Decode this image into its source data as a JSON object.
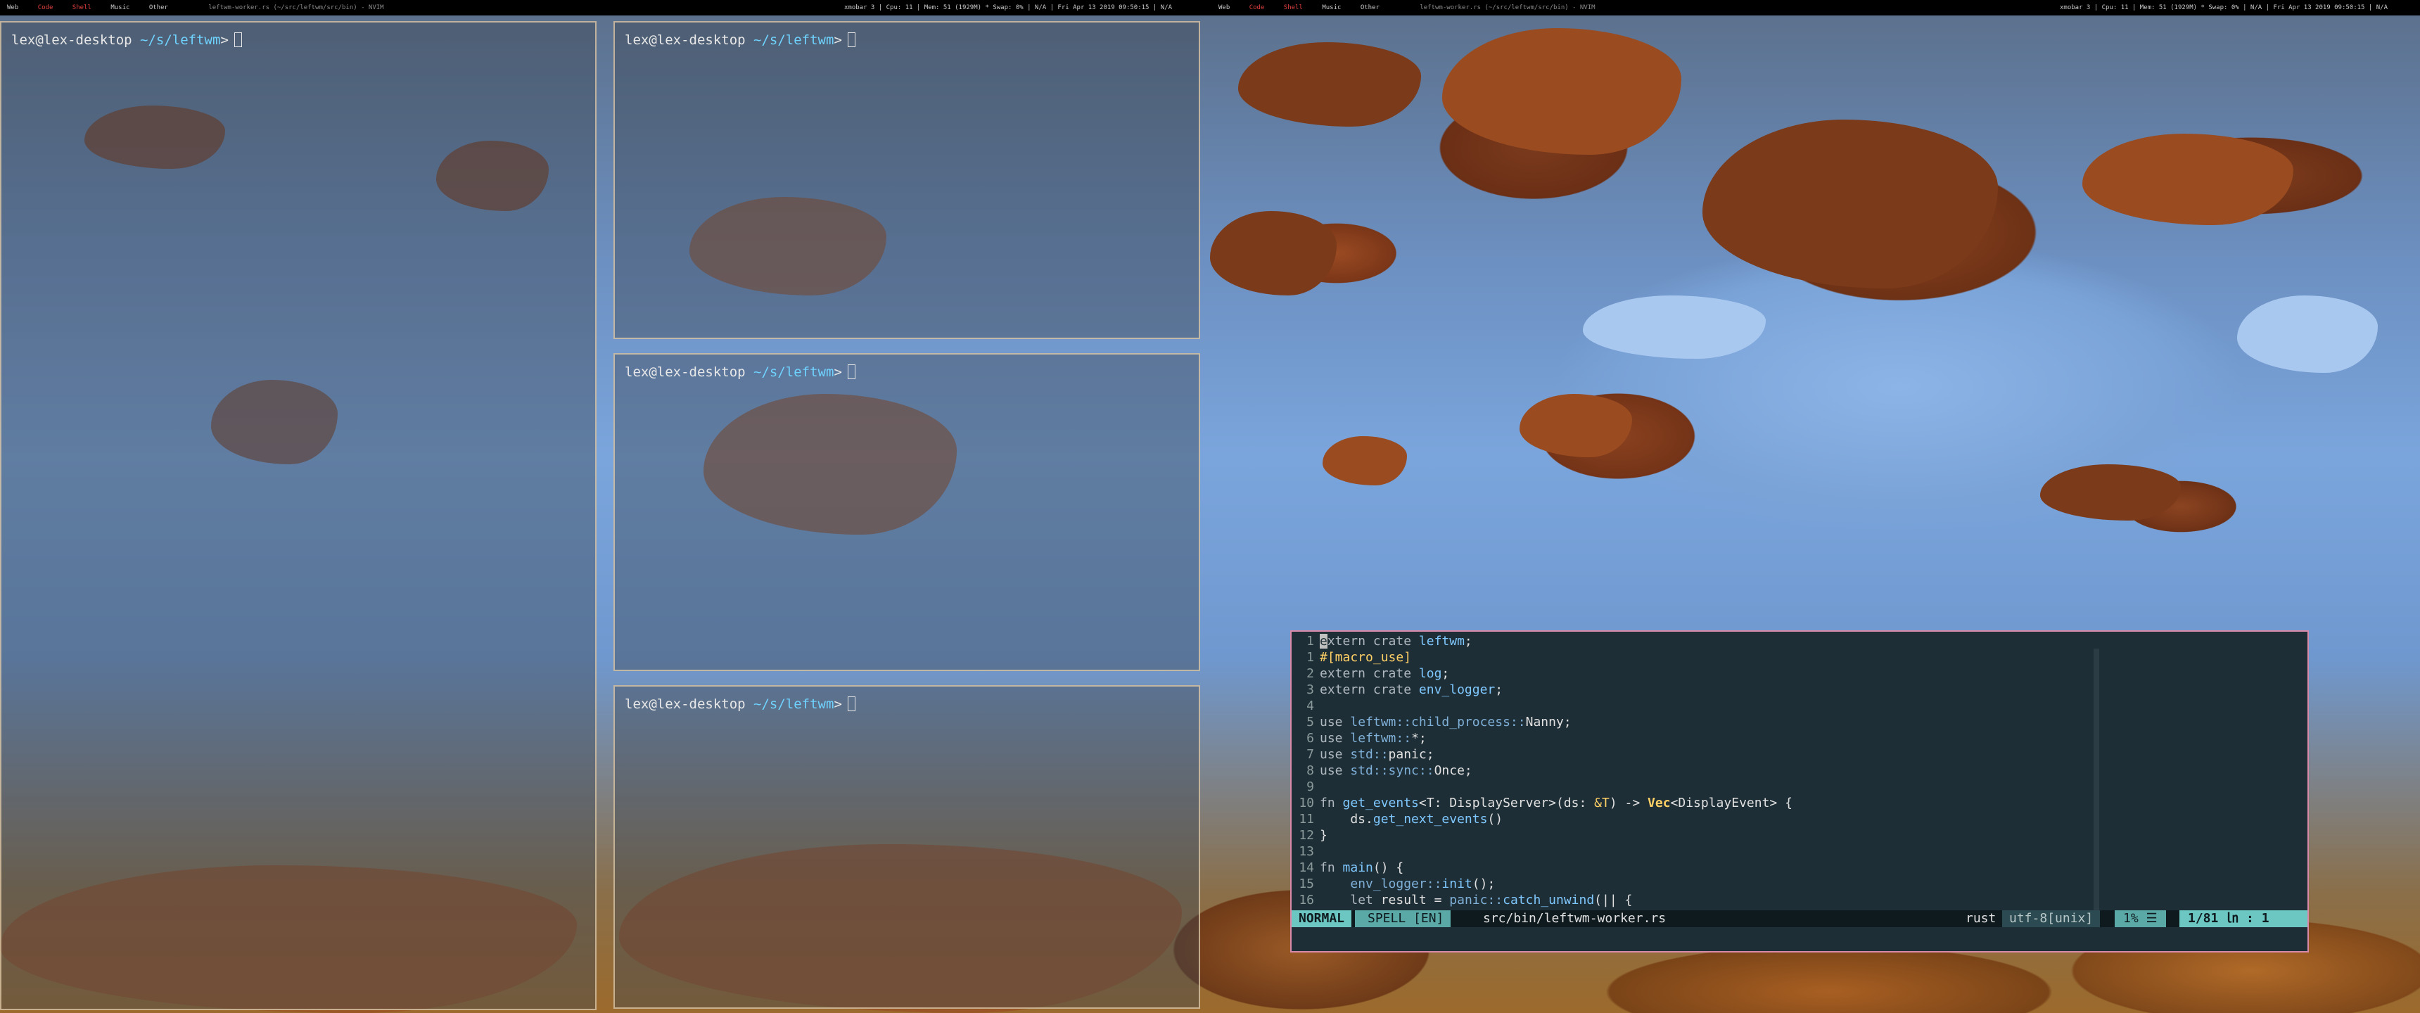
{
  "topbar": {
    "left": {
      "workspaces": [
        "Web",
        "Code",
        "Shell",
        "Music",
        "Other"
      ],
      "active_workspace": "Shell",
      "window_title": "leftwm-worker.rs (~/src/leftwm/src/bin) - NVIM",
      "status": "xmobar 3 | Cpu: 11 | Mem: 51 (1929M) * Swap: 0% | N/A | Fri Apr 13 2019 09:50:15 | N/A"
    },
    "right": {
      "workspaces": [
        "Web",
        "Code",
        "Shell",
        "Music",
        "Other"
      ],
      "active_workspace": "Shell",
      "window_title": "leftwm-worker.rs (~/src/leftwm/src/bin) - NVIM",
      "status": "xmobar 3 | Cpu: 11 | Mem: 51 (1929M) * Swap: 0% | N/A | Fri Apr 13 2019 09:50:15 | N/A"
    }
  },
  "terminals": [
    {
      "user_host": "lex@lex-desktop",
      "path": "~/s/leftwm",
      "symbol": ">"
    },
    {
      "user_host": "lex@lex-desktop",
      "path": "~/s/leftwm",
      "symbol": ">"
    },
    {
      "user_host": "lex@lex-desktop",
      "path": "~/s/leftwm",
      "symbol": ">"
    },
    {
      "user_host": "lex@lex-desktop",
      "path": "~/s/leftwm",
      "symbol": ">"
    }
  ],
  "vim": {
    "lines": [
      {
        "num": "1",
        "tokens": [
          {
            "c": "cur",
            "t": "e"
          },
          {
            "c": "kw2",
            "t": "xtern crate "
          },
          {
            "c": "fnc",
            "t": "leftwm"
          },
          {
            "c": "",
            "t": ";"
          }
        ]
      },
      {
        "num": "1",
        "tokens": [
          {
            "c": "attr",
            "t": "#[macro_use]"
          }
        ]
      },
      {
        "num": "2",
        "tokens": [
          {
            "c": "kw2",
            "t": "extern crate "
          },
          {
            "c": "fnc",
            "t": "log"
          },
          {
            "c": "",
            "t": ";"
          }
        ]
      },
      {
        "num": "3",
        "tokens": [
          {
            "c": "kw2",
            "t": "extern crate "
          },
          {
            "c": "fnc",
            "t": "env_logger"
          },
          {
            "c": "",
            "t": ";"
          }
        ]
      },
      {
        "num": "4",
        "tokens": []
      },
      {
        "num": "5",
        "tokens": [
          {
            "c": "kw2",
            "t": "use "
          },
          {
            "c": "pth",
            "t": "leftwm::child_process::"
          },
          {
            "c": "",
            "t": "Nanny;"
          }
        ]
      },
      {
        "num": "6",
        "tokens": [
          {
            "c": "kw2",
            "t": "use "
          },
          {
            "c": "pth",
            "t": "leftwm::"
          },
          {
            "c": "",
            "t": "*;"
          }
        ]
      },
      {
        "num": "7",
        "tokens": [
          {
            "c": "kw2",
            "t": "use "
          },
          {
            "c": "pth",
            "t": "std::"
          },
          {
            "c": "",
            "t": "panic;"
          }
        ]
      },
      {
        "num": "8",
        "tokens": [
          {
            "c": "kw2",
            "t": "use "
          },
          {
            "c": "pth",
            "t": "std::sync::"
          },
          {
            "c": "",
            "t": "Once;"
          }
        ]
      },
      {
        "num": "9",
        "tokens": []
      },
      {
        "num": "10",
        "tokens": [
          {
            "c": "kw2",
            "t": "fn "
          },
          {
            "c": "fnc",
            "t": "get_events"
          },
          {
            "c": "",
            "t": "<T: DisplayServer>(ds: "
          },
          {
            "c": "attr",
            "t": "&T"
          },
          {
            "c": "",
            "t": ") -> "
          },
          {
            "c": "typ",
            "t": "Vec"
          },
          {
            "c": "",
            "t": "<DisplayEvent> {"
          }
        ]
      },
      {
        "num": "11",
        "tokens": [
          {
            "c": "",
            "t": "    ds."
          },
          {
            "c": "fnc",
            "t": "get_next_events"
          },
          {
            "c": "",
            "t": "()"
          }
        ]
      },
      {
        "num": "12",
        "tokens": [
          {
            "c": "",
            "t": "}"
          }
        ]
      },
      {
        "num": "13",
        "tokens": []
      },
      {
        "num": "14",
        "tokens": [
          {
            "c": "kw2",
            "t": "fn "
          },
          {
            "c": "fnc",
            "t": "main"
          },
          {
            "c": "",
            "t": "() {"
          }
        ]
      },
      {
        "num": "15",
        "tokens": [
          {
            "c": "",
            "t": "    "
          },
          {
            "c": "pth",
            "t": "env_logger::"
          },
          {
            "c": "fnc",
            "t": "init"
          },
          {
            "c": "",
            "t": "();"
          }
        ]
      },
      {
        "num": "16",
        "tokens": [
          {
            "c": "",
            "t": "    "
          },
          {
            "c": "kw2",
            "t": "let "
          },
          {
            "c": "",
            "t": "result = "
          },
          {
            "c": "pth",
            "t": "panic::"
          },
          {
            "c": "fnc",
            "t": "catch_unwind"
          },
          {
            "c": "",
            "t": "(|| {"
          }
        ]
      }
    ],
    "status": {
      "mode": "NORMAL",
      "spell": "SPELL [EN]",
      "file": "src/bin/leftwm-worker.rs",
      "filetype": "rust",
      "encoding": "utf-8[unix]",
      "percent": "1% ☰",
      "position": "1/81 ㏑ :  1"
    }
  }
}
